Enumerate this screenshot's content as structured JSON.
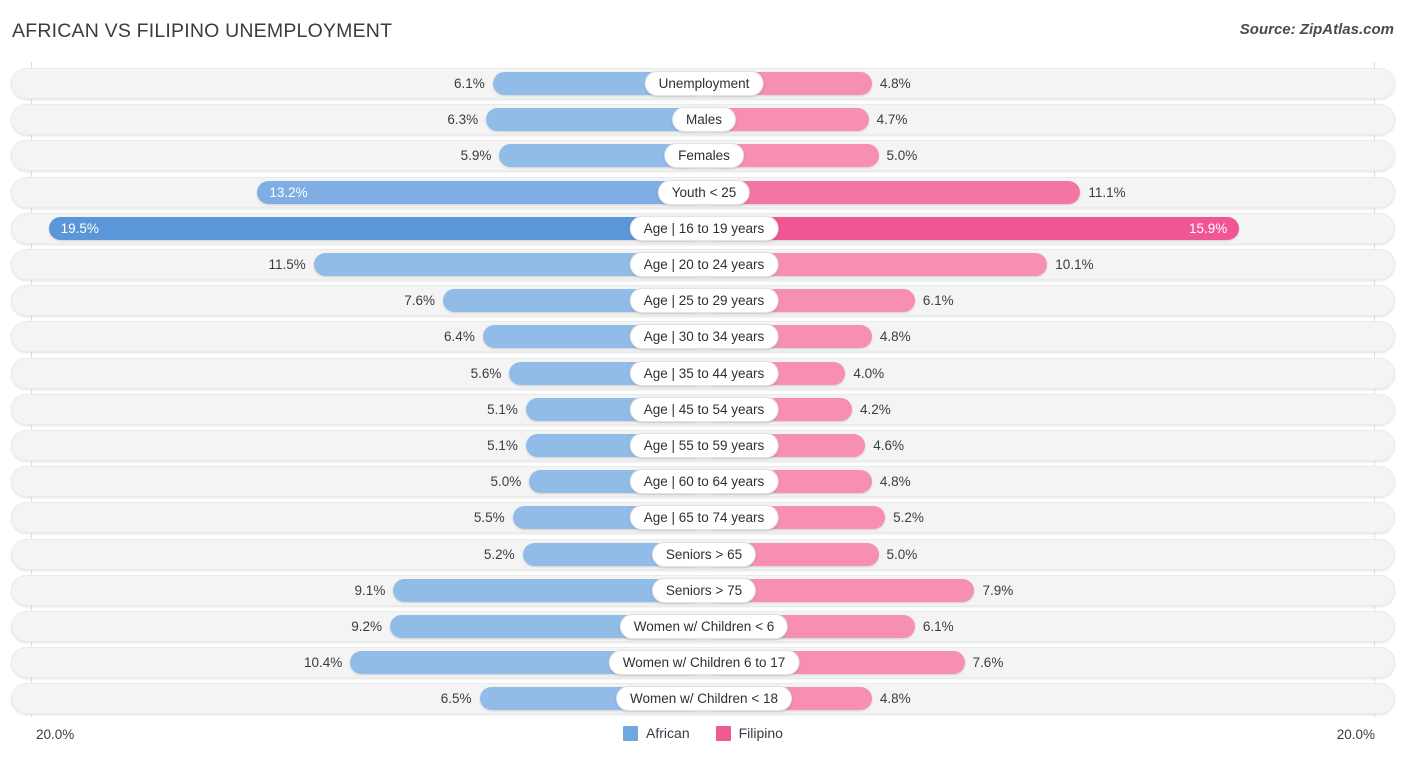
{
  "header": {
    "title": "AFRICAN VS FILIPINO UNEMPLOYMENT",
    "source": "Source: ZipAtlas.com"
  },
  "axis": {
    "left_max_label": "20.0%",
    "right_max_label": "20.0%",
    "max_value": 20.0
  },
  "legend": {
    "items": [
      {
        "label": "African",
        "color": "#6fa8dc"
      },
      {
        "label": "Filipino",
        "color": "#ef5a92"
      }
    ]
  },
  "colors": {
    "left_bar": "#92bce8",
    "left_bar_highlight": "#7eaee3",
    "left_bar_highlight_strong": "#5b96d8",
    "right_bar": "#f78fb3",
    "right_bar_highlight": "#f475a4",
    "right_bar_highlight_strong": "#ef5692",
    "row_track": "#f4f4f4",
    "pill_bg": "#ffffff",
    "text": "#3b3b43"
  },
  "chart_data": {
    "type": "bar",
    "title": "AFRICAN VS FILIPINO UNEMPLOYMENT",
    "subtitle": "Source: ZipAtlas.com",
    "orientation": "horizontal-diverging",
    "xlabel": "",
    "ylabel": "",
    "xlim": [
      20.0,
      20.0
    ],
    "grid": false,
    "legend_position": "bottom-center",
    "categories": [
      "Unemployment",
      "Males",
      "Females",
      "Youth < 25",
      "Age | 16 to 19 years",
      "Age | 20 to 24 years",
      "Age | 25 to 29 years",
      "Age | 30 to 34 years",
      "Age | 35 to 44 years",
      "Age | 45 to 54 years",
      "Age | 55 to 59 years",
      "Age | 60 to 64 years",
      "Age | 65 to 74 years",
      "Seniors > 65",
      "Seniors > 75",
      "Women w/ Children < 6",
      "Women w/ Children 6 to 17",
      "Women w/ Children < 18"
    ],
    "series": [
      {
        "name": "African",
        "side": "left",
        "values": [
          6.1,
          6.3,
          5.9,
          13.2,
          19.5,
          11.5,
          7.6,
          6.4,
          5.6,
          5.1,
          5.1,
          5.0,
          5.5,
          5.2,
          9.1,
          9.2,
          10.4,
          6.5
        ],
        "labels": [
          "6.1%",
          "6.3%",
          "5.9%",
          "13.2%",
          "19.5%",
          "11.5%",
          "7.6%",
          "6.4%",
          "5.6%",
          "5.1%",
          "5.1%",
          "5.0%",
          "5.5%",
          "5.2%",
          "9.1%",
          "9.2%",
          "10.4%",
          "6.5%"
        ]
      },
      {
        "name": "Filipino",
        "side": "right",
        "values": [
          4.8,
          4.7,
          5.0,
          11.1,
          15.9,
          10.1,
          6.1,
          4.8,
          4.0,
          4.2,
          4.6,
          4.8,
          5.2,
          5.0,
          7.9,
          6.1,
          7.6,
          4.8
        ],
        "labels": [
          "4.8%",
          "4.7%",
          "5.0%",
          "11.1%",
          "15.9%",
          "10.1%",
          "6.1%",
          "4.8%",
          "4.0%",
          "4.2%",
          "4.6%",
          "4.8%",
          "5.2%",
          "5.0%",
          "7.9%",
          "6.1%",
          "7.6%",
          "4.8%"
        ]
      }
    ]
  },
  "rows": [
    {
      "label": "Unemployment",
      "left": "6.1%",
      "right": "4.8%",
      "left_val": 6.1,
      "right_val": 4.8
    },
    {
      "label": "Males",
      "left": "6.3%",
      "right": "4.7%",
      "left_val": 6.3,
      "right_val": 4.7
    },
    {
      "label": "Females",
      "left": "5.9%",
      "right": "5.0%",
      "left_val": 5.9,
      "right_val": 5.0
    },
    {
      "label": "Youth < 25",
      "left": "13.2%",
      "right": "11.1%",
      "left_val": 13.2,
      "right_val": 11.1
    },
    {
      "label": "Age | 16 to 19 years",
      "left": "19.5%",
      "right": "15.9%",
      "left_val": 19.5,
      "right_val": 15.9
    },
    {
      "label": "Age | 20 to 24 years",
      "left": "11.5%",
      "right": "10.1%",
      "left_val": 11.5,
      "right_val": 10.1
    },
    {
      "label": "Age | 25 to 29 years",
      "left": "7.6%",
      "right": "6.1%",
      "left_val": 7.6,
      "right_val": 6.1
    },
    {
      "label": "Age | 30 to 34 years",
      "left": "6.4%",
      "right": "4.8%",
      "left_val": 6.4,
      "right_val": 4.8
    },
    {
      "label": "Age | 35 to 44 years",
      "left": "5.6%",
      "right": "4.0%",
      "left_val": 5.6,
      "right_val": 4.0
    },
    {
      "label": "Age | 45 to 54 years",
      "left": "5.1%",
      "right": "4.2%",
      "left_val": 5.1,
      "right_val": 4.2
    },
    {
      "label": "Age | 55 to 59 years",
      "left": "5.1%",
      "right": "4.6%",
      "left_val": 5.1,
      "right_val": 4.6
    },
    {
      "label": "Age | 60 to 64 years",
      "left": "5.0%",
      "right": "4.8%",
      "left_val": 5.0,
      "right_val": 4.8
    },
    {
      "label": "Age | 65 to 74 years",
      "left": "5.5%",
      "right": "5.2%",
      "left_val": 5.5,
      "right_val": 5.2
    },
    {
      "label": "Seniors > 65",
      "left": "5.2%",
      "right": "5.0%",
      "left_val": 5.2,
      "right_val": 5.0
    },
    {
      "label": "Seniors > 75",
      "left": "9.1%",
      "right": "7.9%",
      "left_val": 9.1,
      "right_val": 7.9
    },
    {
      "label": "Women w/ Children < 6",
      "left": "9.2%",
      "right": "6.1%",
      "left_val": 9.2,
      "right_val": 6.1
    },
    {
      "label": "Women w/ Children 6 to 17",
      "left": "10.4%",
      "right": "7.6%",
      "left_val": 10.4,
      "right_val": 7.6
    },
    {
      "label": "Women w/ Children < 18",
      "left": "6.5%",
      "right": "4.8%",
      "left_val": 6.5,
      "right_val": 4.8
    }
  ]
}
